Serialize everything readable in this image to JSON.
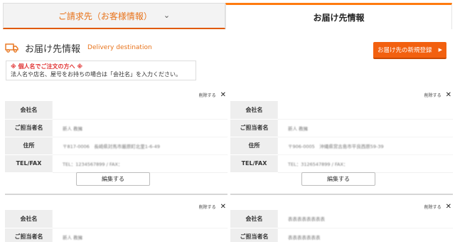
{
  "tabs": {
    "billing_label": "ご請求先（お客様情報）",
    "delivery_label": "お届け先情報"
  },
  "header": {
    "title": "お届け先情報",
    "subtitle": "Delivery destination",
    "new_button_label": "お届け先の新規登録"
  },
  "notice": {
    "title": "※ 個人名でご注文の方へ ※",
    "body": "法人名や店名、屋号をお持ちの場合は「会社名」を入力ください。"
  },
  "labels": {
    "delete": "削除する",
    "company": "会社名",
    "contact": "ご担当者名",
    "address": "住所",
    "telfax": "TEL/FAX",
    "edit": "編集する"
  },
  "cards": [
    {
      "company": "",
      "contact": "新人 教擁",
      "address": "〒817-0006　長崎県対馬市厳原町北里1-6-49",
      "telfax": "TEL：1234567899 / FAX："
    },
    {
      "company": "",
      "contact": "新人 教擁",
      "address": "〒906-0005　沖縄県宮古島市平良西原59-39",
      "telfax": "TEL：3126547899 / FAX："
    },
    {
      "company": "",
      "contact": "新人 教擁"
    },
    {
      "company": "表表表表表表表表",
      "contact": "表表表表表表表"
    }
  ],
  "colors": {
    "accent": "#f2600f",
    "accent_text": "#e8731b",
    "notice_red": "#e03030"
  }
}
